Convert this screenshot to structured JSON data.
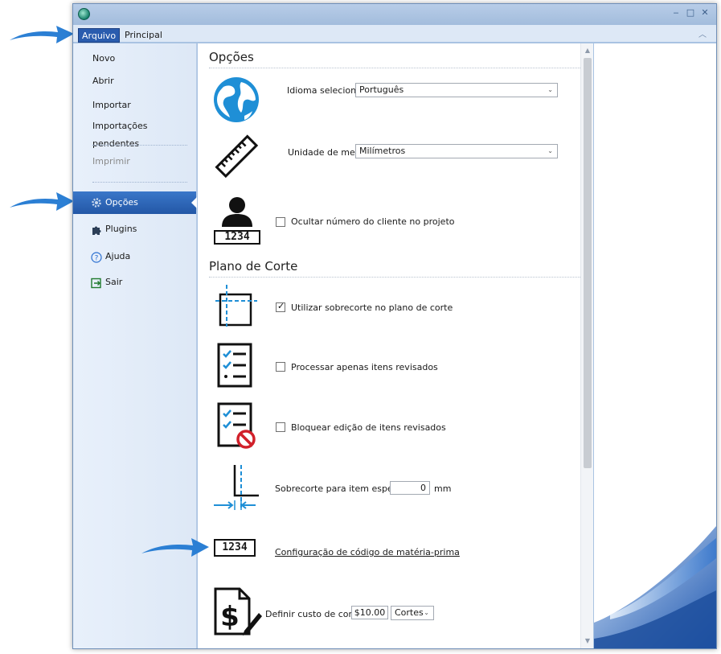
{
  "ribbon": {
    "tab_arquivo": "Arquivo",
    "tab_principal": "Principal"
  },
  "window_controls": {
    "minimize": "‒",
    "maximize": "□",
    "close": "✕"
  },
  "sidebar": {
    "items": [
      {
        "label": "Novo"
      },
      {
        "label": "Abrir"
      },
      {
        "label": "Importar"
      },
      {
        "label": "Importações pendentes"
      },
      {
        "label": "Imprimir"
      },
      {
        "label": "Opções"
      },
      {
        "label": "Plugins"
      },
      {
        "label": "Ajuda"
      },
      {
        "label": "Sair"
      }
    ]
  },
  "options": {
    "title": "Opções",
    "language_label": "Idioma selecionado:",
    "language_value": "Português",
    "unit_label": "Unidade de medida:",
    "unit_value": "Milímetros",
    "hide_client_label": "Ocultar número do cliente no projeto",
    "client_badge": "1234"
  },
  "cutting_plan": {
    "title": "Plano de Corte",
    "oversize_label": "Utilizar sobrecorte no plano de corte",
    "oversize_checked": true,
    "reviewed_only_label": "Processar apenas itens revisados",
    "lock_reviewed_label": "Bloquear edição de itens revisados",
    "special_oversize_label": "Sobrecorte para item especial",
    "special_oversize_value": "0",
    "special_oversize_unit": "mm",
    "material_code_badge": "1234",
    "material_code_link": "Configuração de código de matéria-prima",
    "cost_label": "Definir custo de corte",
    "cost_value": "$10.00",
    "cost_unit": "Cortes"
  },
  "colors": {
    "accent": "#2a5cae",
    "icon_blue": "#1f8fd6",
    "arrow_blue": "#2b7fd4"
  }
}
